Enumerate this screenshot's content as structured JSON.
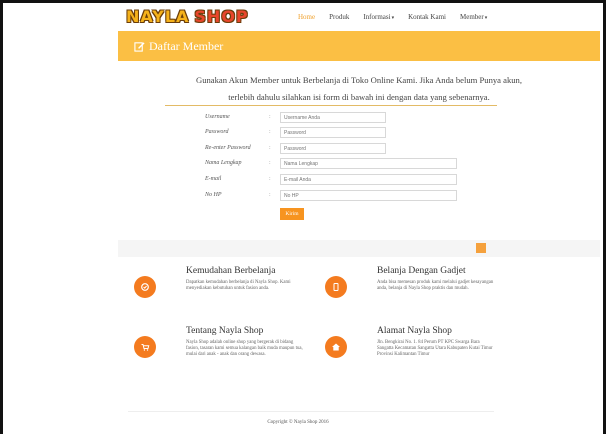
{
  "brand": {
    "logo_word1": "NAYLA",
    "logo_word2": "SHOP"
  },
  "nav": {
    "items": [
      {
        "label": "Home",
        "active": true,
        "dropdown": false
      },
      {
        "label": "Produk",
        "active": false,
        "dropdown": false
      },
      {
        "label": "Informasi",
        "active": false,
        "dropdown": true
      },
      {
        "label": "Kontak Kami",
        "active": false,
        "dropdown": false
      },
      {
        "label": "Member",
        "active": false,
        "dropdown": true
      }
    ]
  },
  "header": {
    "title": "Daftar Member",
    "icon": "edit-icon"
  },
  "intro": {
    "line1": "Gunakan Akun Member untuk Berbelanja di Toko Online Kami. Jika Anda belum Punya akun,",
    "line2": "terlebih dahulu silahkan isi form di bawah ini dengan data yang sebenarnya."
  },
  "form": {
    "fields": [
      {
        "label": "Username",
        "placeholder": "Username Anda",
        "value": ""
      },
      {
        "label": "Password",
        "placeholder": "Password",
        "value": ""
      },
      {
        "label": "Re-enter Password",
        "placeholder": "Password",
        "value": ""
      },
      {
        "label": "Nama Lengkap",
        "placeholder": "Nama Lengkap",
        "value": ""
      },
      {
        "label": "E-mail",
        "placeholder": "E-mail Anda",
        "value": ""
      },
      {
        "label": "No HP",
        "placeholder": "No HP",
        "value": ""
      }
    ],
    "colon": ":",
    "submit_label": "Kirim"
  },
  "features": [
    {
      "title": "Kemudahan Berbelanja",
      "icon": "check-circle-icon",
      "desc": "Dapatkan kemudahan berbelanja di Nayla Shop. Kami menyediakan kebutuhan untuk fasion anda."
    },
    {
      "title": "Belanja Dengan Gadjet",
      "icon": "mobile-icon",
      "desc": "Anda bisa memesan produk kami melalui gadjet kesayangan anda, belanja di Nayla Shop praktis dan mudah."
    },
    {
      "title": "Tentang Nayla Shop",
      "icon": "cart-icon",
      "desc": "Nayla Shop adalah online shop yang bergerak di bidang fasion, tasaran kami semua kalangan baik muda maupun tua, mulai dari anak - anak dan orang dewasa."
    },
    {
      "title": "Alamat Nayla Shop",
      "icon": "home-icon",
      "desc": "Jln. Bengkirai No. 1. 84 Perum PT KPC Swarga Bara Sangatta Kecamatan Sangatta Utara Kabupaten Kutai Timur Provinsi Kalimantan Timur"
    }
  ],
  "footer": {
    "copyright": "Copyright © Nayla Shop 2016"
  },
  "colors": {
    "accent": "#fbbf44",
    "button": "#f79420",
    "icon_circle": "#f47b1f"
  }
}
